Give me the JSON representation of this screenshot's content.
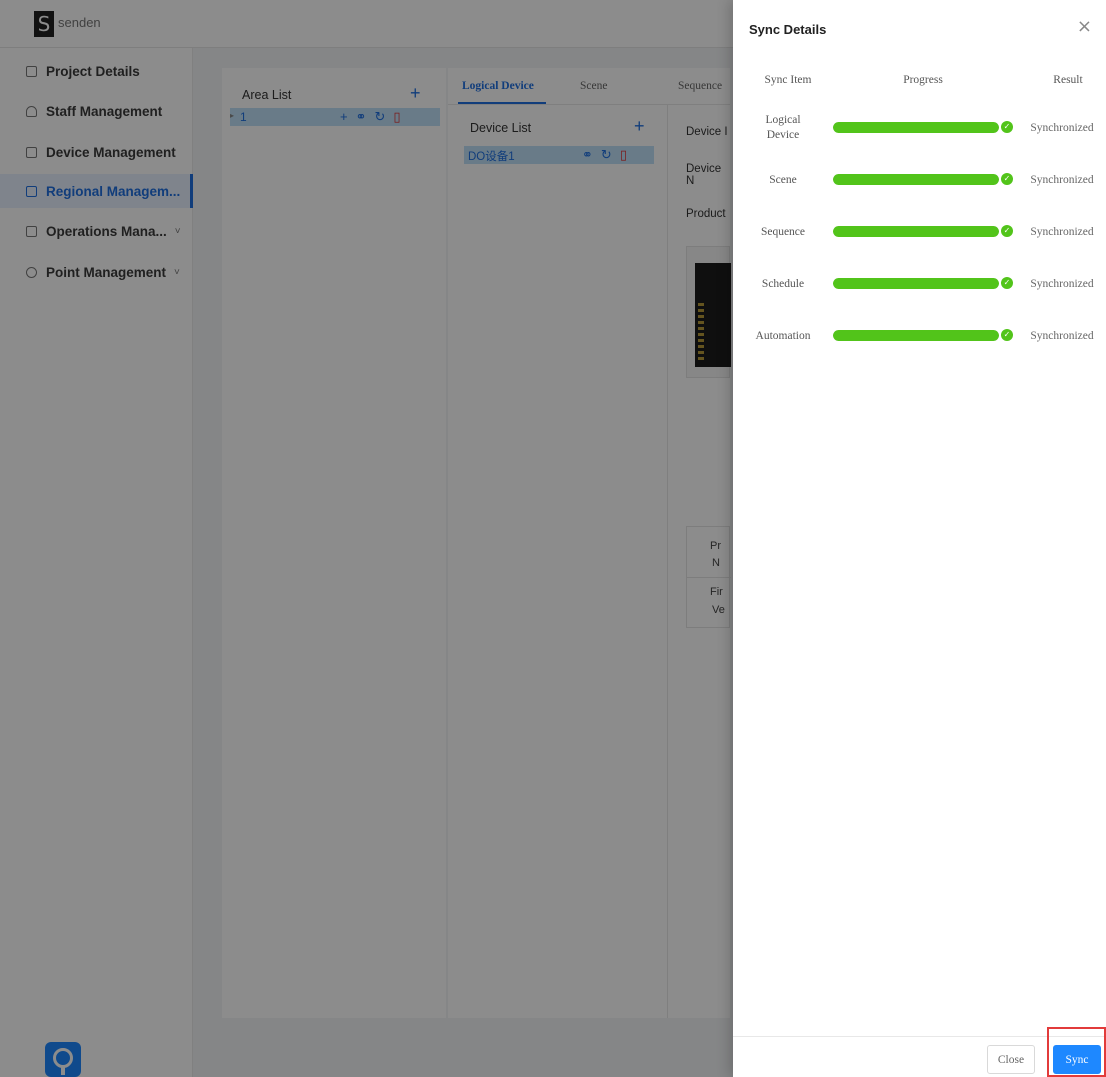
{
  "app": {
    "logo_letter": "S",
    "brand": "senden"
  },
  "sidebar": {
    "items": [
      {
        "label": "Project Details",
        "icon": "document-icon"
      },
      {
        "label": "Staff Management",
        "icon": "person-icon"
      },
      {
        "label": "Device Management",
        "icon": "device-icon"
      },
      {
        "label": "Regional Managem...",
        "icon": "region-icon",
        "active": true
      },
      {
        "label": "Operations Mana...",
        "icon": "operations-icon",
        "chevron": "˅"
      },
      {
        "label": "Point Management",
        "icon": "pin-icon",
        "chevron": "˅"
      }
    ]
  },
  "area_panel": {
    "title": "Area List",
    "add": "+",
    "row": {
      "expander": "▸",
      "name": "1"
    }
  },
  "device_panel": {
    "tabs": [
      "Logical Device",
      "Scene",
      "Sequence"
    ],
    "device_list_title": "Device List",
    "add": "+",
    "device_name": "DO设备1",
    "detail_fragments": [
      "Device I",
      "Device N",
      "Product"
    ],
    "table_fragments": [
      "Pr",
      "N",
      "Fir",
      "Ve"
    ]
  },
  "drawer": {
    "title": "Sync Details",
    "close_glyph": "×",
    "columns": {
      "item": "Sync Item",
      "progress": "Progress",
      "result": "Result"
    },
    "rows": [
      {
        "item": "Logical\nDevice",
        "progress": 1.0,
        "result": "Synchronized"
      },
      {
        "item": "Scene",
        "progress": 1.0,
        "result": "Synchronized"
      },
      {
        "item": "Sequence",
        "progress": 1.0,
        "result": "Synchronized"
      },
      {
        "item": "Schedule",
        "progress": 1.0,
        "result": "Synchronized"
      },
      {
        "item": "Automation",
        "progress": 1.0,
        "result": "Synchronized"
      }
    ],
    "check_glyph": "✓",
    "buttons": {
      "close": "Close",
      "sync": "Sync"
    }
  },
  "colors": {
    "accent": "#1e88ff",
    "success": "#52c41a",
    "highlight": "#e23b3b"
  }
}
